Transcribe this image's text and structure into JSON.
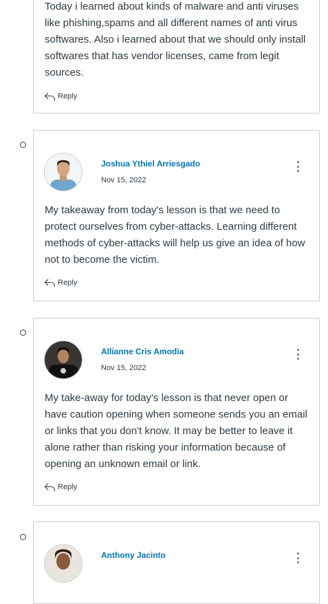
{
  "posts": [
    {
      "message": "Today i learned about kinds of malware and anti viruses like phishing,spams and all different names of anti virus softwares. Also i learned about that we should only install softwares that has vendor licenses, came from legit sources.",
      "reply_label": "Reply"
    },
    {
      "author": "Joshua Ythiel Arriesgado",
      "date": "Nov 15, 2022",
      "message": "My takeaway from today's lesson is that we need to protect ourselves from cyber-attacks. Learning different methods of cyber-attacks will help us give an idea of how not to become the victim.",
      "reply_label": "Reply"
    },
    {
      "author": "Allianne Cris Amodia",
      "date": "Nov 15, 2022",
      "message": "My take-away for today's lesson is that never open or have caution opening when someone sends you an email or links that you don't know. It may be better to leave it alone rather than risking your information because of opening an unknown email or link.",
      "reply_label": "Reply"
    },
    {
      "author": "Anthony Jacinto"
    }
  ],
  "colors": {
    "link": "#0374b5",
    "text": "#2d3b45",
    "border": "#c7cdd1"
  }
}
